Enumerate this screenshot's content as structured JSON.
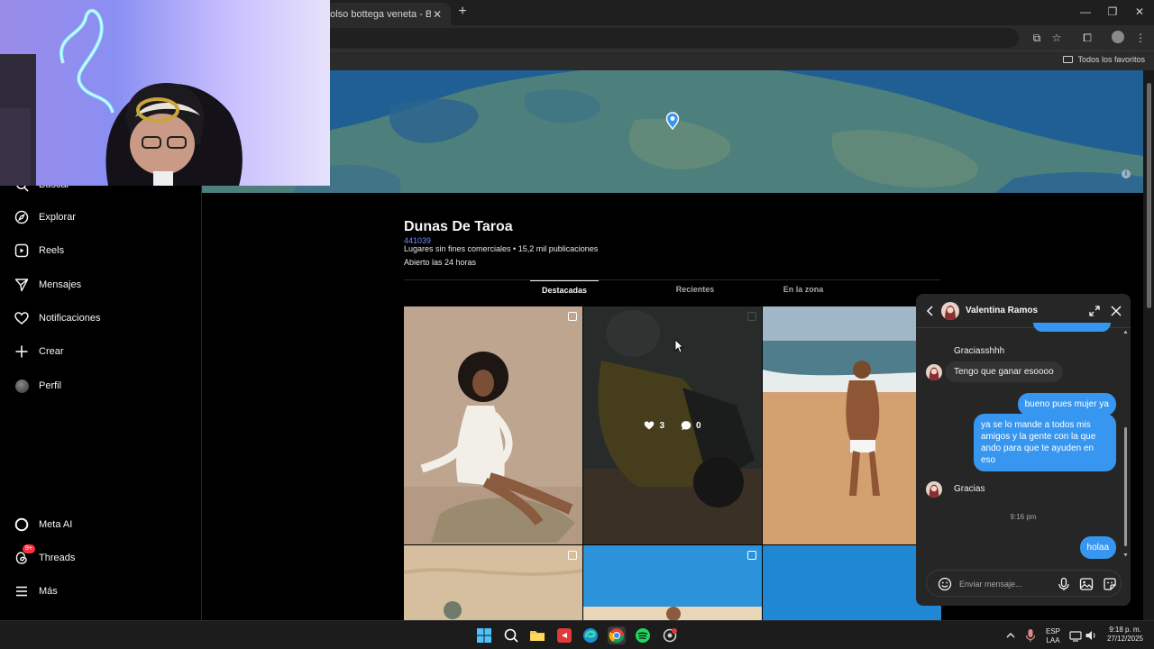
{
  "browser": {
    "tab_title": "bolso bottega veneta - Buscar",
    "tab_close": "✕",
    "new_tab": "+",
    "bookmark_folder": "Todos los favoritos"
  },
  "sidebar": {
    "search": "Buscar",
    "items": [
      {
        "label": "Explorar",
        "icon": "compass-icon"
      },
      {
        "label": "Reels",
        "icon": "reels-icon"
      },
      {
        "label": "Mensajes",
        "icon": "send-icon"
      },
      {
        "label": "Notificaciones",
        "icon": "heart-icon"
      },
      {
        "label": "Crear",
        "icon": "plus-icon"
      },
      {
        "label": "Perfil",
        "icon": "avatar"
      }
    ],
    "bottom": [
      {
        "label": "Meta AI",
        "icon": "meta-ai-icon"
      },
      {
        "label": "Threads",
        "icon": "threads-icon",
        "badge": "9+"
      },
      {
        "label": "Más",
        "icon": "menu-icon"
      }
    ]
  },
  "place": {
    "title": "Dunas De Taroa",
    "code": "441039",
    "meta": "Lugares sin fines comerciales • 15,2 mil publicaciones",
    "hours": "Abierto las 24 horas",
    "tabs": [
      "Destacadas",
      "Recientes",
      "En la zona"
    ],
    "active_tab": "Destacadas"
  },
  "post_hover": {
    "likes": "3",
    "comments": "0"
  },
  "chat": {
    "name": "Valentina Ramos",
    "messages": [
      {
        "side": "in",
        "text": "Graciasshhh"
      },
      {
        "side": "in",
        "text": "Tengo que ganar esoooo"
      },
      {
        "side": "out",
        "text": "bueno pues mujer ya"
      },
      {
        "side": "out",
        "text": "ya se lo mande a todos mis amigos y la gente con la que ando para que te ayuden en eso"
      },
      {
        "side": "in",
        "text": "Gracias"
      },
      {
        "side": "time",
        "text": "9:16 pm"
      },
      {
        "side": "out",
        "text": "holaa"
      }
    ],
    "input_placeholder": "Enviar mensaje..."
  },
  "taskbar": {
    "lang_line1": "ESP",
    "lang_line2": "LAA",
    "time": "9:18 p. m.",
    "date": "27/12/2025"
  },
  "colors": {
    "accent": "#3797f0",
    "link": "#6d8dff",
    "badge": "#ff3040",
    "map_sea": "#1e5f92"
  }
}
